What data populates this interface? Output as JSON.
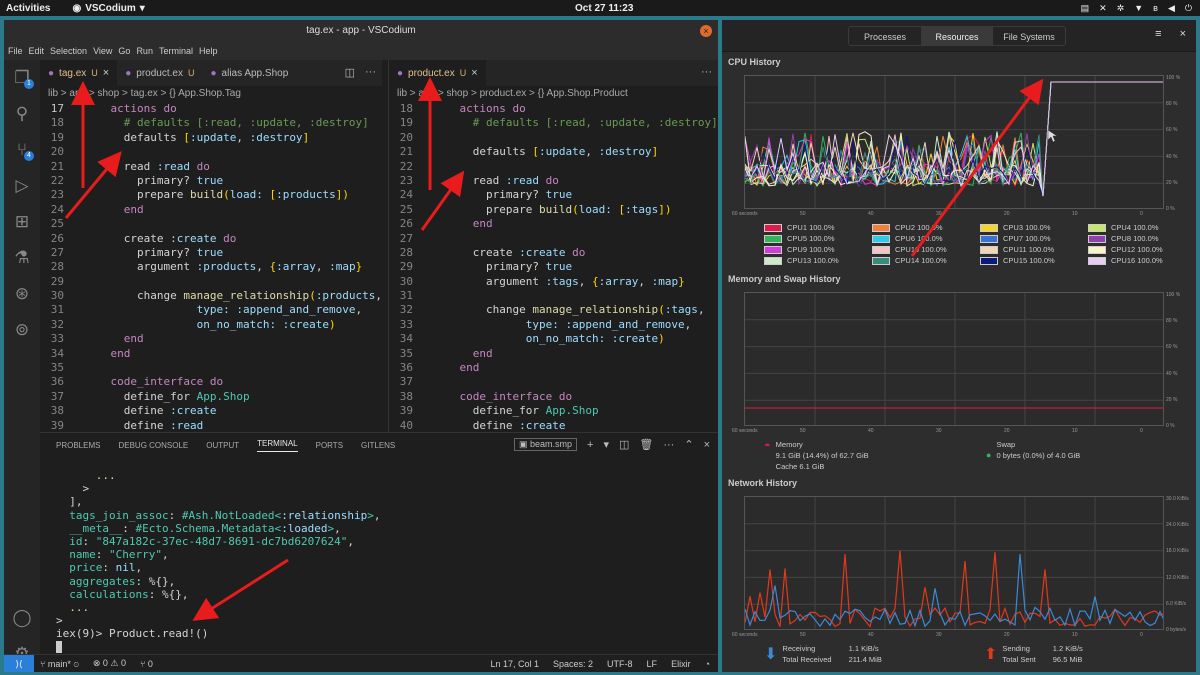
{
  "topbar": {
    "activities": "Activities",
    "app": "VSCodium",
    "clock": "Oct 27  11:23"
  },
  "vscode": {
    "title": "tag.ex - app - VSCodium",
    "menu": [
      "File",
      "Edit",
      "Selection",
      "View",
      "Go",
      "Run",
      "Terminal",
      "Help"
    ],
    "badges": {
      "explorer": "1",
      "scm": "4"
    },
    "left": {
      "tabs": [
        {
          "label": "tag.ex",
          "mod": "U",
          "close": "×"
        },
        {
          "label": "product.ex",
          "mod": "U",
          "close": ""
        },
        {
          "label": "alias App.Shop",
          "mod": "",
          "close": ""
        }
      ],
      "breadcrumb": "lib  >  app  >  shop  >   tag.ex  >  {} App.Shop.Tag",
      "lines": [
        {
          "n": "17",
          "cur": true,
          "segs": [
            [
              "t",
              "    "
            ],
            [
              "k",
              "actions"
            ],
            [
              "t",
              " "
            ],
            [
              "k",
              "do"
            ]
          ]
        },
        {
          "n": "18",
          "segs": [
            [
              "t",
              "      "
            ],
            [
              "c",
              "# defaults [:read, :update, :destroy]"
            ]
          ]
        },
        {
          "n": "19",
          "segs": [
            [
              "t",
              "      defaults "
            ],
            [
              "g",
              "["
            ],
            [
              "a",
              ":update"
            ],
            [
              "t",
              ", "
            ],
            [
              "a",
              ":destroy"
            ],
            [
              "g",
              "]"
            ]
          ]
        },
        {
          "n": "20",
          "segs": [
            [
              "t",
              ""
            ]
          ]
        },
        {
          "n": "21",
          "segs": [
            [
              "t",
              "      read "
            ],
            [
              "a",
              ":read"
            ],
            [
              "t",
              " "
            ],
            [
              "k",
              "do"
            ]
          ]
        },
        {
          "n": "22",
          "segs": [
            [
              "t",
              "        primary? "
            ],
            [
              "a",
              "true"
            ]
          ]
        },
        {
          "n": "23",
          "segs": [
            [
              "t",
              "        prepare "
            ],
            [
              "y",
              "build"
            ],
            [
              "g",
              "("
            ],
            [
              "a",
              "load: "
            ],
            [
              "g",
              "["
            ],
            [
              "a",
              ":products"
            ],
            [
              "g",
              "])"
            ]
          ]
        },
        {
          "n": "24",
          "segs": [
            [
              "t",
              "      "
            ],
            [
              "k",
              "end"
            ]
          ]
        },
        {
          "n": "25",
          "segs": [
            [
              "t",
              ""
            ]
          ]
        },
        {
          "n": "26",
          "segs": [
            [
              "t",
              "      create "
            ],
            [
              "a",
              ":create"
            ],
            [
              "t",
              " "
            ],
            [
              "k",
              "do"
            ]
          ]
        },
        {
          "n": "27",
          "segs": [
            [
              "t",
              "        primary? "
            ],
            [
              "a",
              "true"
            ]
          ]
        },
        {
          "n": "28",
          "segs": [
            [
              "t",
              "        argument "
            ],
            [
              "a",
              ":products"
            ],
            [
              "t",
              ", "
            ],
            [
              "g",
              "{"
            ],
            [
              "a",
              ":array"
            ],
            [
              "t",
              ", "
            ],
            [
              "a",
              ":map"
            ],
            [
              "g",
              "}"
            ]
          ]
        },
        {
          "n": "29",
          "segs": [
            [
              "t",
              ""
            ]
          ]
        },
        {
          "n": "30",
          "segs": [
            [
              "t",
              "        change "
            ],
            [
              "y",
              "manage_relationship"
            ],
            [
              "g",
              "("
            ],
            [
              "a",
              ":products"
            ],
            [
              "t",
              ","
            ]
          ]
        },
        {
          "n": "31",
          "segs": [
            [
              "t",
              "                 "
            ],
            [
              "a",
              "type: :append_and_remove"
            ],
            [
              "t",
              ","
            ]
          ]
        },
        {
          "n": "32",
          "segs": [
            [
              "t",
              "                 "
            ],
            [
              "a",
              "on_no_match: :create"
            ],
            [
              "g",
              ")"
            ]
          ]
        },
        {
          "n": "33",
          "segs": [
            [
              "t",
              "      "
            ],
            [
              "k",
              "end"
            ]
          ]
        },
        {
          "n": "34",
          "segs": [
            [
              "t",
              "    "
            ],
            [
              "k",
              "end"
            ]
          ]
        },
        {
          "n": "35",
          "segs": [
            [
              "t",
              ""
            ]
          ]
        },
        {
          "n": "36",
          "segs": [
            [
              "t",
              "    "
            ],
            [
              "k",
              "code_interface"
            ],
            [
              "t",
              " "
            ],
            [
              "k",
              "do"
            ]
          ]
        },
        {
          "n": "37",
          "segs": [
            [
              "t",
              "      define_for "
            ],
            [
              "b",
              "App.Shop"
            ]
          ]
        },
        {
          "n": "38",
          "segs": [
            [
              "t",
              "      define "
            ],
            [
              "a",
              ":create"
            ]
          ]
        },
        {
          "n": "39",
          "segs": [
            [
              "t",
              "      define "
            ],
            [
              "a",
              ":read"
            ]
          ]
        }
      ]
    },
    "right": {
      "tabs": [
        {
          "label": "product.ex",
          "mod": "U",
          "close": "×"
        }
      ],
      "breadcrumb": "lib  >  app  >  shop  >   product.ex  >  {} App.Shop.Product",
      "lines": [
        {
          "n": "18",
          "segs": [
            [
              "t",
              "    "
            ],
            [
              "k",
              "actions"
            ],
            [
              "t",
              " "
            ],
            [
              "k",
              "do"
            ]
          ]
        },
        {
          "n": "19",
          "segs": [
            [
              "t",
              "      "
            ],
            [
              "c",
              "# defaults [:read, :update, :destroy]"
            ]
          ]
        },
        {
          "n": "20",
          "segs": [
            [
              "t",
              ""
            ]
          ]
        },
        {
          "n": "21",
          "segs": [
            [
              "t",
              "      defaults "
            ],
            [
              "g",
              "["
            ],
            [
              "a",
              ":update"
            ],
            [
              "t",
              ", "
            ],
            [
              "a",
              ":destroy"
            ],
            [
              "g",
              "]"
            ]
          ]
        },
        {
          "n": "22",
          "segs": [
            [
              "t",
              ""
            ]
          ]
        },
        {
          "n": "23",
          "segs": [
            [
              "t",
              "      read "
            ],
            [
              "a",
              ":read"
            ],
            [
              "t",
              " "
            ],
            [
              "k",
              "do"
            ]
          ]
        },
        {
          "n": "24",
          "segs": [
            [
              "t",
              "        primary? "
            ],
            [
              "a",
              "true"
            ]
          ]
        },
        {
          "n": "25",
          "segs": [
            [
              "t",
              "        prepare "
            ],
            [
              "y",
              "build"
            ],
            [
              "g",
              "("
            ],
            [
              "a",
              "load: "
            ],
            [
              "g",
              "["
            ],
            [
              "a",
              ":tags"
            ],
            [
              "g",
              "])"
            ]
          ]
        },
        {
          "n": "26",
          "segs": [
            [
              "t",
              "      "
            ],
            [
              "k",
              "end"
            ]
          ]
        },
        {
          "n": "27",
          "segs": [
            [
              "t",
              ""
            ]
          ]
        },
        {
          "n": "28",
          "segs": [
            [
              "t",
              "      create "
            ],
            [
              "a",
              ":create"
            ],
            [
              "t",
              " "
            ],
            [
              "k",
              "do"
            ]
          ]
        },
        {
          "n": "29",
          "segs": [
            [
              "t",
              "        primary? "
            ],
            [
              "a",
              "true"
            ]
          ]
        },
        {
          "n": "30",
          "segs": [
            [
              "t",
              "        argument "
            ],
            [
              "a",
              ":tags"
            ],
            [
              "t",
              ", "
            ],
            [
              "g",
              "{"
            ],
            [
              "a",
              ":array"
            ],
            [
              "t",
              ", "
            ],
            [
              "a",
              ":map"
            ],
            [
              "g",
              "}"
            ]
          ]
        },
        {
          "n": "31",
          "segs": [
            [
              "t",
              ""
            ]
          ]
        },
        {
          "n": "32",
          "segs": [
            [
              "t",
              "        change "
            ],
            [
              "y",
              "manage_relationship"
            ],
            [
              "g",
              "("
            ],
            [
              "a",
              ":tags"
            ],
            [
              "t",
              ","
            ]
          ]
        },
        {
          "n": "33",
          "segs": [
            [
              "t",
              "              "
            ],
            [
              "a",
              "type: :append_and_remove"
            ],
            [
              "t",
              ","
            ]
          ]
        },
        {
          "n": "34",
          "segs": [
            [
              "t",
              "              "
            ],
            [
              "a",
              "on_no_match: :create"
            ],
            [
              "g",
              ")"
            ]
          ]
        },
        {
          "n": "35",
          "segs": [
            [
              "t",
              "      "
            ],
            [
              "k",
              "end"
            ]
          ]
        },
        {
          "n": "36",
          "segs": [
            [
              "t",
              "    "
            ],
            [
              "k",
              "end"
            ]
          ]
        },
        {
          "n": "37",
          "segs": [
            [
              "t",
              ""
            ]
          ]
        },
        {
          "n": "38",
          "segs": [
            [
              "t",
              "    "
            ],
            [
              "k",
              "code_interface"
            ],
            [
              "t",
              " "
            ],
            [
              "k",
              "do"
            ]
          ]
        },
        {
          "n": "39",
          "segs": [
            [
              "t",
              "      define_for "
            ],
            [
              "b",
              "App.Shop"
            ]
          ]
        },
        {
          "n": "40",
          "segs": [
            [
              "t",
              "      define "
            ],
            [
              "a",
              ":create"
            ]
          ]
        }
      ]
    },
    "panel": {
      "tabs": [
        "PROBLEMS",
        "DEBUG CONSOLE",
        "OUTPUT",
        "TERMINAL",
        "PORTS",
        "GITLENS"
      ],
      "active": "TERMINAL",
      "terminal_name": "beam.smp",
      "lines": [
        [
          [
            "y",
            "      ..."
          ]
        ],
        [
          [
            "t",
            "    >"
          ]
        ],
        [
          [
            "t",
            "  ],"
          ]
        ],
        [
          [
            "b",
            "  tags_join_assoc"
          ],
          [
            "t",
            ": "
          ],
          [
            "b",
            "#Ash.NotLoaded<"
          ],
          [
            "a",
            ":relationship"
          ],
          [
            "b",
            ">"
          ],
          [
            "t",
            ","
          ]
        ],
        [
          [
            "b",
            "  __meta__"
          ],
          [
            "t",
            ": "
          ],
          [
            "b",
            "#Ecto.Schema.Metadata<"
          ],
          [
            "a",
            ":loaded"
          ],
          [
            "b",
            ">"
          ],
          [
            "t",
            ","
          ]
        ],
        [
          [
            "b",
            "  id"
          ],
          [
            "t",
            ": "
          ],
          [
            "b",
            "\"847a182c-37ec-48d7-8691-dc7bd6207624\""
          ],
          [
            "t",
            ","
          ]
        ],
        [
          [
            "b",
            "  name"
          ],
          [
            "t",
            ": "
          ],
          [
            "b",
            "\"Cherry\""
          ],
          [
            "t",
            ","
          ]
        ],
        [
          [
            "b",
            "  price"
          ],
          [
            "t",
            ": "
          ],
          [
            "a",
            "nil"
          ],
          [
            "t",
            ","
          ]
        ],
        [
          [
            "b",
            "  aggregates"
          ],
          [
            "t",
            ": %{},"
          ]
        ],
        [
          [
            "b",
            "  calculations"
          ],
          [
            "t",
            ": %{},"
          ]
        ],
        [
          [
            "y",
            "  ..."
          ]
        ],
        [
          [
            "t",
            ">"
          ]
        ],
        [
          [
            "t",
            "iex(9)> Product.read!()"
          ]
        ]
      ]
    },
    "status": {
      "branch": "main*",
      "sync": "⊙",
      "errors": "⊗ 0 ⚠ 0",
      "ports": "⑂ 0",
      "pos": "Ln 17, Col 1",
      "spaces": "Spaces: 2",
      "enc": "UTF-8",
      "eol": "LF",
      "lang": "Elixir"
    }
  },
  "sysmon": {
    "tabs": [
      "Processes",
      "Resources",
      "File Systems"
    ],
    "active": "Resources",
    "sections": {
      "cpu": "CPU History",
      "mem": "Memory and Swap History",
      "net": "Network History"
    },
    "cpu_yticks": [
      "100 %",
      "80 %",
      "60 %",
      "40 %",
      "20 %",
      "0 %"
    ],
    "net_yticks": [
      "30.0 KiB/s",
      "24.0 KiB/s",
      "18.0 KiB/s",
      "12.0 KiB/s",
      "6.0 KiB/s",
      "0 bytes/s"
    ],
    "xticks": [
      "60 seconds",
      "50",
      "40",
      "30",
      "20",
      "10",
      "0"
    ],
    "cpu_legend": [
      {
        "label": "CPU1  100.0%",
        "color": "#e01b4c"
      },
      {
        "label": "CPU2  100.0%",
        "color": "#f0803c"
      },
      {
        "label": "CPU3  100.0%",
        "color": "#f6d32d"
      },
      {
        "label": "CPU4  100.0%",
        "color": "#c6e86a"
      },
      {
        "label": "CPU5  100.0%",
        "color": "#33b35a"
      },
      {
        "label": "CPU6  100.0%",
        "color": "#33c7e8"
      },
      {
        "label": "CPU7  100.0%",
        "color": "#3a73d6"
      },
      {
        "label": "CPU8  100.0%",
        "color": "#9141ac"
      },
      {
        "label": "CPU9  100.0%",
        "color": "#d33bd8"
      },
      {
        "label": "CPU10  100.0%",
        "color": "#f4c5c5"
      },
      {
        "label": "CPU11  100.0%",
        "color": "#f0d5b8"
      },
      {
        "label": "CPU12  100.0%",
        "color": "#f9f3c8"
      },
      {
        "label": "CPU13  100.0%",
        "color": "#cde9c6"
      },
      {
        "label": "CPU14  100.0%",
        "color": "#3a8a7e"
      },
      {
        "label": "CPU15  100.0%",
        "color": "#0c1a7a"
      },
      {
        "label": "CPU16  100.0%",
        "color": "#e8cdf2"
      }
    ],
    "memory": {
      "label": "Memory",
      "value": "9.1 GiB (14.4%) of 62.7 GiB",
      "cache": "Cache 6.1 GiB",
      "color": "#e01b4c"
    },
    "swap": {
      "label": "Swap",
      "value": "0 bytes (0.0%) of 4.0 GiB",
      "color": "#33b35a"
    },
    "network": {
      "receiving": {
        "label": "Receiving",
        "total_label": "Total Received",
        "rate": "1.1 KiB/s",
        "total": "211.4 MiB"
      },
      "sending": {
        "label": "Sending",
        "total_label": "Total Sent",
        "rate": "1.2 KiB/s",
        "total": "96.5 MiB"
      }
    }
  }
}
